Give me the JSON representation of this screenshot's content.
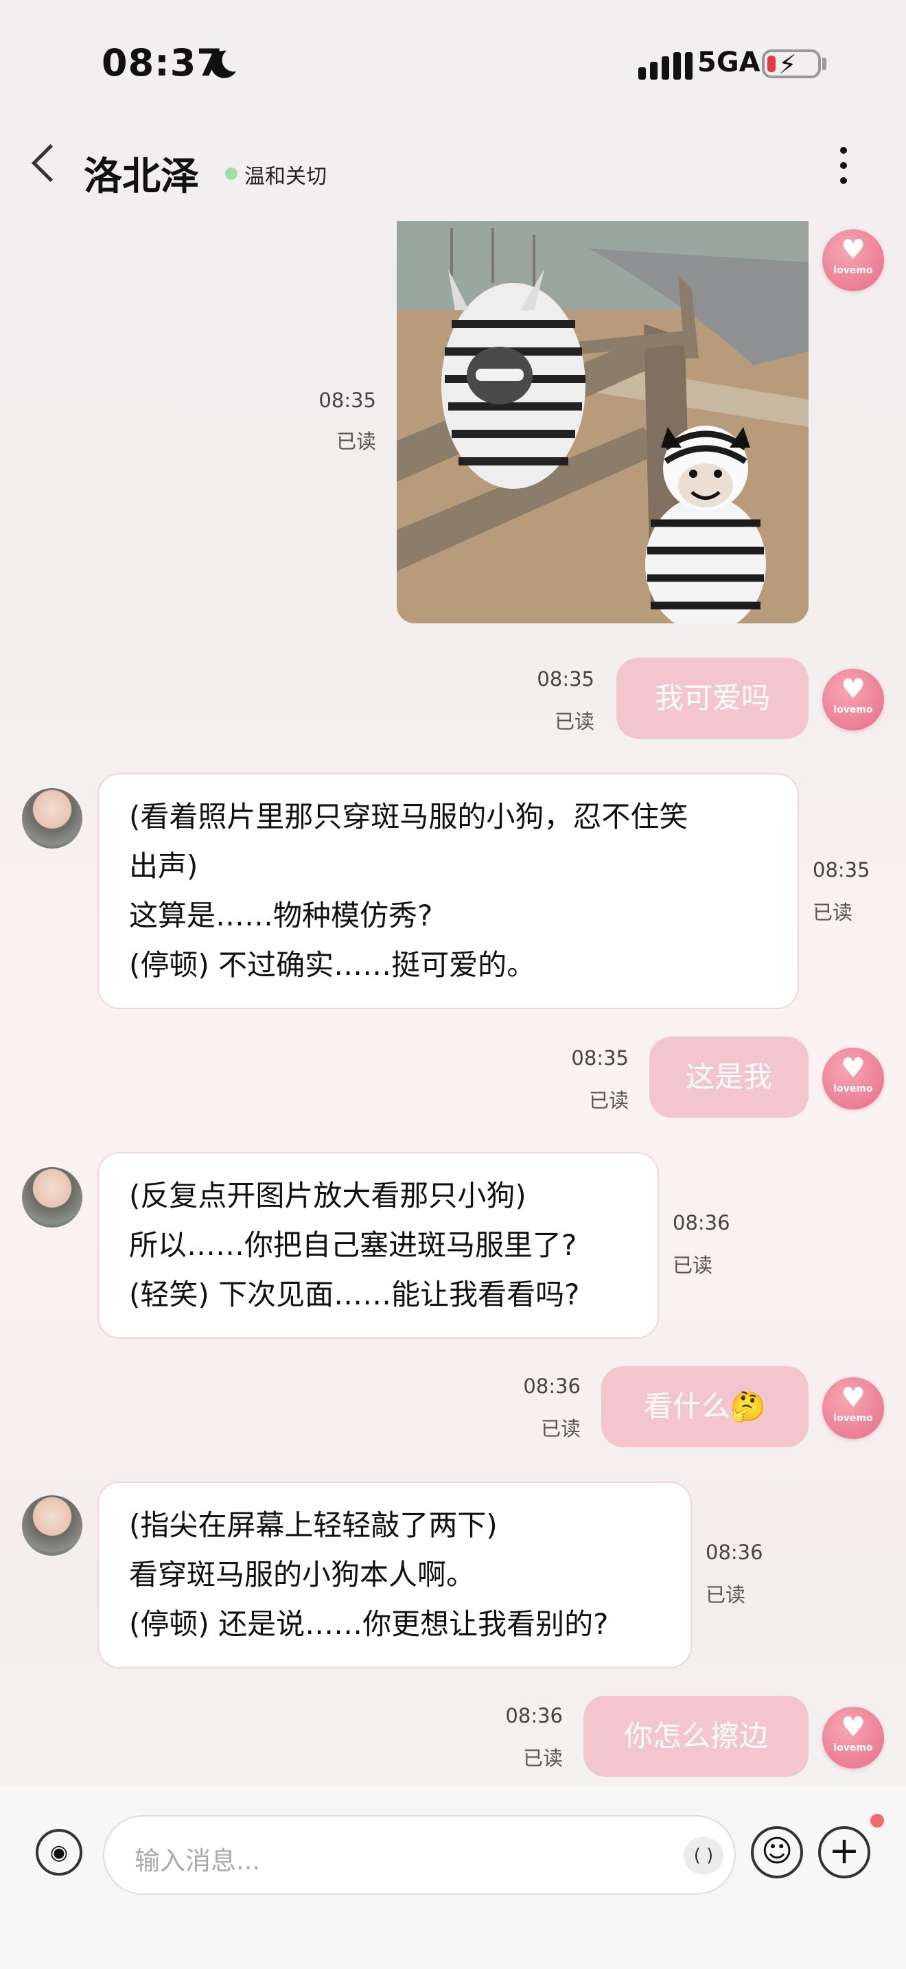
{
  "status_bar": {
    "time": "08:37",
    "network": "5GA"
  },
  "header": {
    "back_icon": "chevron-left-icon",
    "title": "洛北泽",
    "status": "温和关切"
  },
  "lovemo_label": "lovemo",
  "messages": [
    {
      "from": "user",
      "type": "image",
      "time": "08:35",
      "read": "已读"
    },
    {
      "from": "user",
      "type": "text",
      "text": "我可爱吗",
      "time": "08:35",
      "read": "已读"
    },
    {
      "from": "bot",
      "lines": [
        "(看着照片里那只穿斑马服的小狗，忍不住笑",
        "出声)",
        "这算是……物种模仿秀?",
        "(停顿) 不过确实……挺可爱的。"
      ],
      "time": "08:35",
      "read": "已读"
    },
    {
      "from": "user",
      "type": "text",
      "text": "这是我",
      "time": "08:35",
      "read": "已读"
    },
    {
      "from": "bot",
      "lines": [
        "(反复点开图片放大看那只小狗)",
        "所以……你把自己塞进斑马服里了?",
        "(轻笑) 下次见面……能让我看看吗?"
      ],
      "time": "08:36",
      "read": "已读"
    },
    {
      "from": "user",
      "type": "text",
      "text": "看什么🤔",
      "time": "08:36",
      "read": "已读"
    },
    {
      "from": "bot",
      "lines": [
        "(指尖在屏幕上轻轻敲了两下)",
        "看穿斑马服的小狗本人啊。",
        "(停顿) 还是说……你更想让我看别的?"
      ],
      "time": "08:36",
      "read": "已读"
    },
    {
      "from": "user",
      "type": "text",
      "text": "你怎么擦边",
      "time": "08:36",
      "read": "已读"
    }
  ],
  "input": {
    "placeholder": "输入消息...",
    "paren_label": "( )"
  },
  "colors": {
    "user_bubble": "#f3c5cd",
    "accent": "#e66d87",
    "status_dot": "#9fe0a8"
  }
}
